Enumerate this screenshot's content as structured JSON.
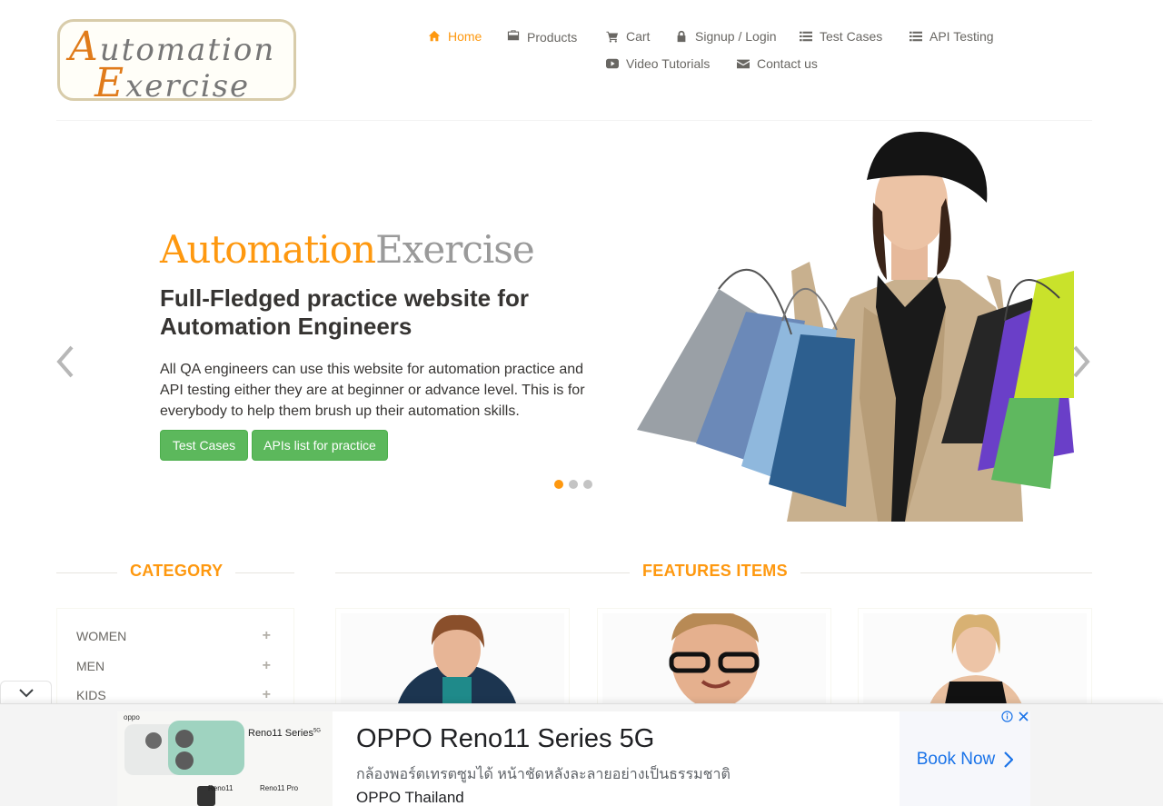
{
  "logo": {
    "line1_first": "A",
    "line1_rest": "utomation",
    "line2_first": "E",
    "line2_rest": "xercise"
  },
  "nav": {
    "home": "Home",
    "products": "Products",
    "cart": "Cart",
    "signup_login": "Signup / Login",
    "test_cases": "Test Cases",
    "api_testing": "API Testing",
    "video_tutorials": "Video Tutorials",
    "contact_us": "Contact us"
  },
  "slider": {
    "brand_a": "Automation",
    "brand_b": "Exercise",
    "heading": "Full-Fledged practice website for Automation Engineers",
    "text": "All QA engineers can use this website for automation practice and API testing either they are at beginner or advance level. This is for everybody to help them brush up their automation skills.",
    "btn_test_cases": "Test Cases",
    "btn_apis": "APIs list for practice",
    "active_slide": 1,
    "slide_count": 3
  },
  "category": {
    "title": "CATEGORY",
    "items": [
      {
        "label": "WOMEN",
        "toggle": "+"
      },
      {
        "label": "MEN",
        "toggle": "+"
      },
      {
        "label": "KIDS",
        "toggle": "+"
      }
    ]
  },
  "features": {
    "title": "FEATURES ITEMS"
  },
  "ad": {
    "headline": "OPPO Reno11 Series 5G",
    "description": "กล้องพอร์ตเทรตซูมได้ หน้าชัดหลังละลายอย่างเป็นธรรมชาติ",
    "advertiser": "OPPO Thailand",
    "cta": "Book Now",
    "image_brand": "oppo",
    "image_title": "Reno11 Series",
    "image_title_sup": "5G",
    "image_model_1": "Reno11",
    "image_model_2": "Reno11 Pro"
  },
  "colors": {
    "accent": "#fe980f",
    "button_green": "#5cb85c",
    "text": "#696763"
  }
}
